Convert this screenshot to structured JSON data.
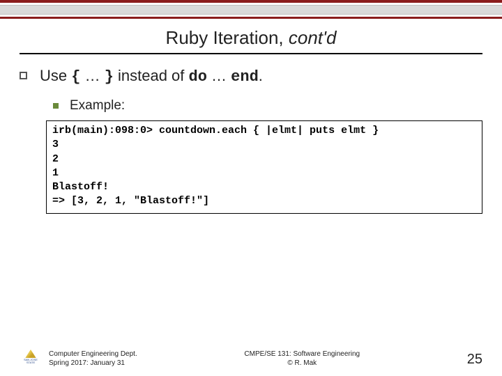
{
  "title": {
    "pre": "Ruby Iteration, ",
    "italic": "cont'd"
  },
  "bullet": {
    "t1": "Use ",
    "m1": "{",
    "t2": " … ",
    "m2": "}",
    "t3": " instead of ",
    "m3": "do",
    "t4": " … ",
    "m4": "end",
    "t5": "."
  },
  "sub": {
    "label": "Example:"
  },
  "code": "irb(main):098:0> countdown.each { |elmt| puts elmt }\n3\n2\n1\nBlastoff!\n=> [3, 2, 1, \"Blastoff!\"]",
  "footer": {
    "left1": "Computer Engineering Dept.",
    "left2": "Spring 2017: January 31",
    "center1": "CMPE/SE 131: Software Engineering",
    "center2": "© R. Mak",
    "page": "25",
    "uni": "SAN JOSE STATE"
  }
}
